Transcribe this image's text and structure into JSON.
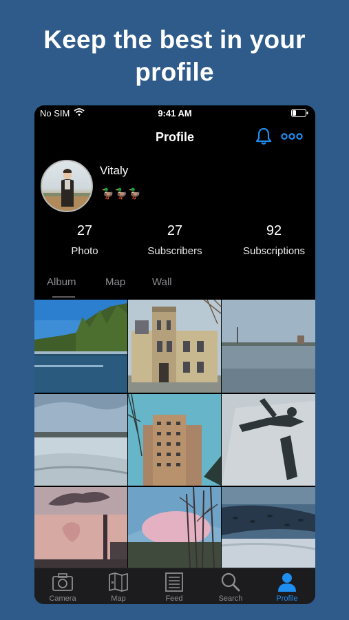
{
  "headline": {
    "line1": "Keep the best in your",
    "line2": "profile"
  },
  "status_bar": {
    "carrier": "No SIM",
    "time": "9:41 AM",
    "icons": [
      "wifi-icon",
      "battery-icon"
    ]
  },
  "nav": {
    "title": "Profile",
    "icons": [
      "bell-icon",
      "more-icon"
    ],
    "accent_color": "#1f8ef1"
  },
  "profile": {
    "name": "Vitaly",
    "badges": "🦆🦆🦆"
  },
  "stats": [
    {
      "value": "27",
      "label": "Photo"
    },
    {
      "value": "27",
      "label": "Subscribers"
    },
    {
      "value": "92",
      "label": "Subscriptions"
    }
  ],
  "tabs": [
    {
      "label": "Album",
      "selected": true
    },
    {
      "label": "Map",
      "selected": false
    },
    {
      "label": "Wall",
      "selected": false
    }
  ],
  "photos_count_visible": 9,
  "tab_bar": [
    {
      "label": "Camera",
      "icon": "camera-icon",
      "active": false
    },
    {
      "label": "Map",
      "icon": "map-icon",
      "active": false
    },
    {
      "label": "Feed",
      "icon": "feed-icon",
      "active": false
    },
    {
      "label": "Search",
      "icon": "search-icon",
      "active": false
    },
    {
      "label": "Profile",
      "icon": "person-icon",
      "active": true
    }
  ],
  "colors": {
    "background": "#2f5b8a",
    "accent": "#1f8ef1",
    "inactive": "#8e8e93"
  }
}
